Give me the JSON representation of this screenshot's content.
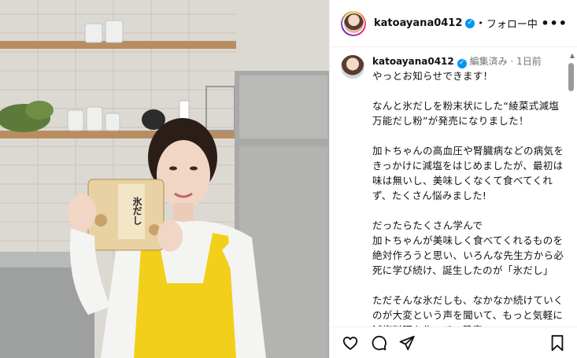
{
  "post": {
    "username": "katoayana0412",
    "follow_state": "フォロー中",
    "separator": "•",
    "more_label": "•••"
  },
  "caption": {
    "username": "katoayana0412",
    "edited": "編集済み",
    "separator": "·",
    "time": "1日前",
    "text": "やっとお知らせできます！\n\nなんと氷だしを粉末状にした“綾菜式減塩 万能だし粉”が発売になりました！\n\n加トちゃんの高血圧や腎臓病などの病気をきっかけに減塩をはじめましたが、最初は味は無いし、美味しくなくて食べてくれず、たくさん悩みました!\n\nだったらたくさん学んで\n加トちゃんが美味しく食べてくれるものを絶対作ろうと思い、いろんな先生方から必死に学び続け、誕生したのが「氷だし」\n\nただそんな氷だしも、なかなか続けていくのが大変という声を聞いて、もっと気軽に減塩料理を作って、健康"
  },
  "product": {
    "label": "氷だし"
  },
  "icons": {
    "verified": "verified-badge-icon",
    "like": "heart-icon",
    "comment": "comment-bubble-icon",
    "share": "paper-plane-icon",
    "save": "bookmark-icon",
    "more": "more-options-icon"
  },
  "colors": {
    "verified": "#0095f6",
    "apron": "#f2cf1a",
    "text": "#111111",
    "secondary": "#737373"
  }
}
